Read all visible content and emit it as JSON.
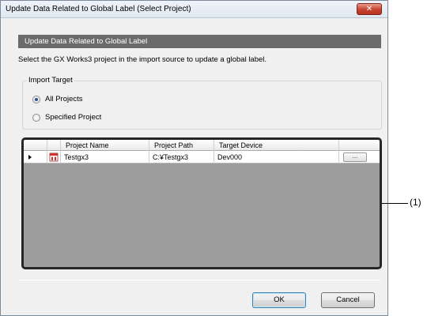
{
  "window": {
    "title": "Update Data Related to Global Label (Select Project)",
    "close_glyph": "✕"
  },
  "section_header": "Update Data Related to Global Label",
  "instruction": "Select the GX Works3 project in the import source to update a global label.",
  "import_target": {
    "title": "Import Target",
    "options": [
      {
        "label": "All Projects",
        "selected": true
      },
      {
        "label": "Specified Project",
        "selected": false
      }
    ]
  },
  "grid": {
    "columns": [
      "Project Name",
      "Project Path",
      "Target Device"
    ],
    "rows": [
      {
        "project_name": "Testgx3",
        "project_path": "C:¥Testgx3",
        "target_device": "Dev000",
        "browse_label": "..."
      }
    ],
    "icon": "project-file-icon"
  },
  "buttons": {
    "ok": "OK",
    "cancel": "Cancel"
  },
  "callout": "(1)",
  "colors": {
    "section_header_bg": "#6b6b6b",
    "grid_empty_bg": "#9e9e9e",
    "close_button": "#c7432f",
    "icon_red": "#d0312d"
  }
}
